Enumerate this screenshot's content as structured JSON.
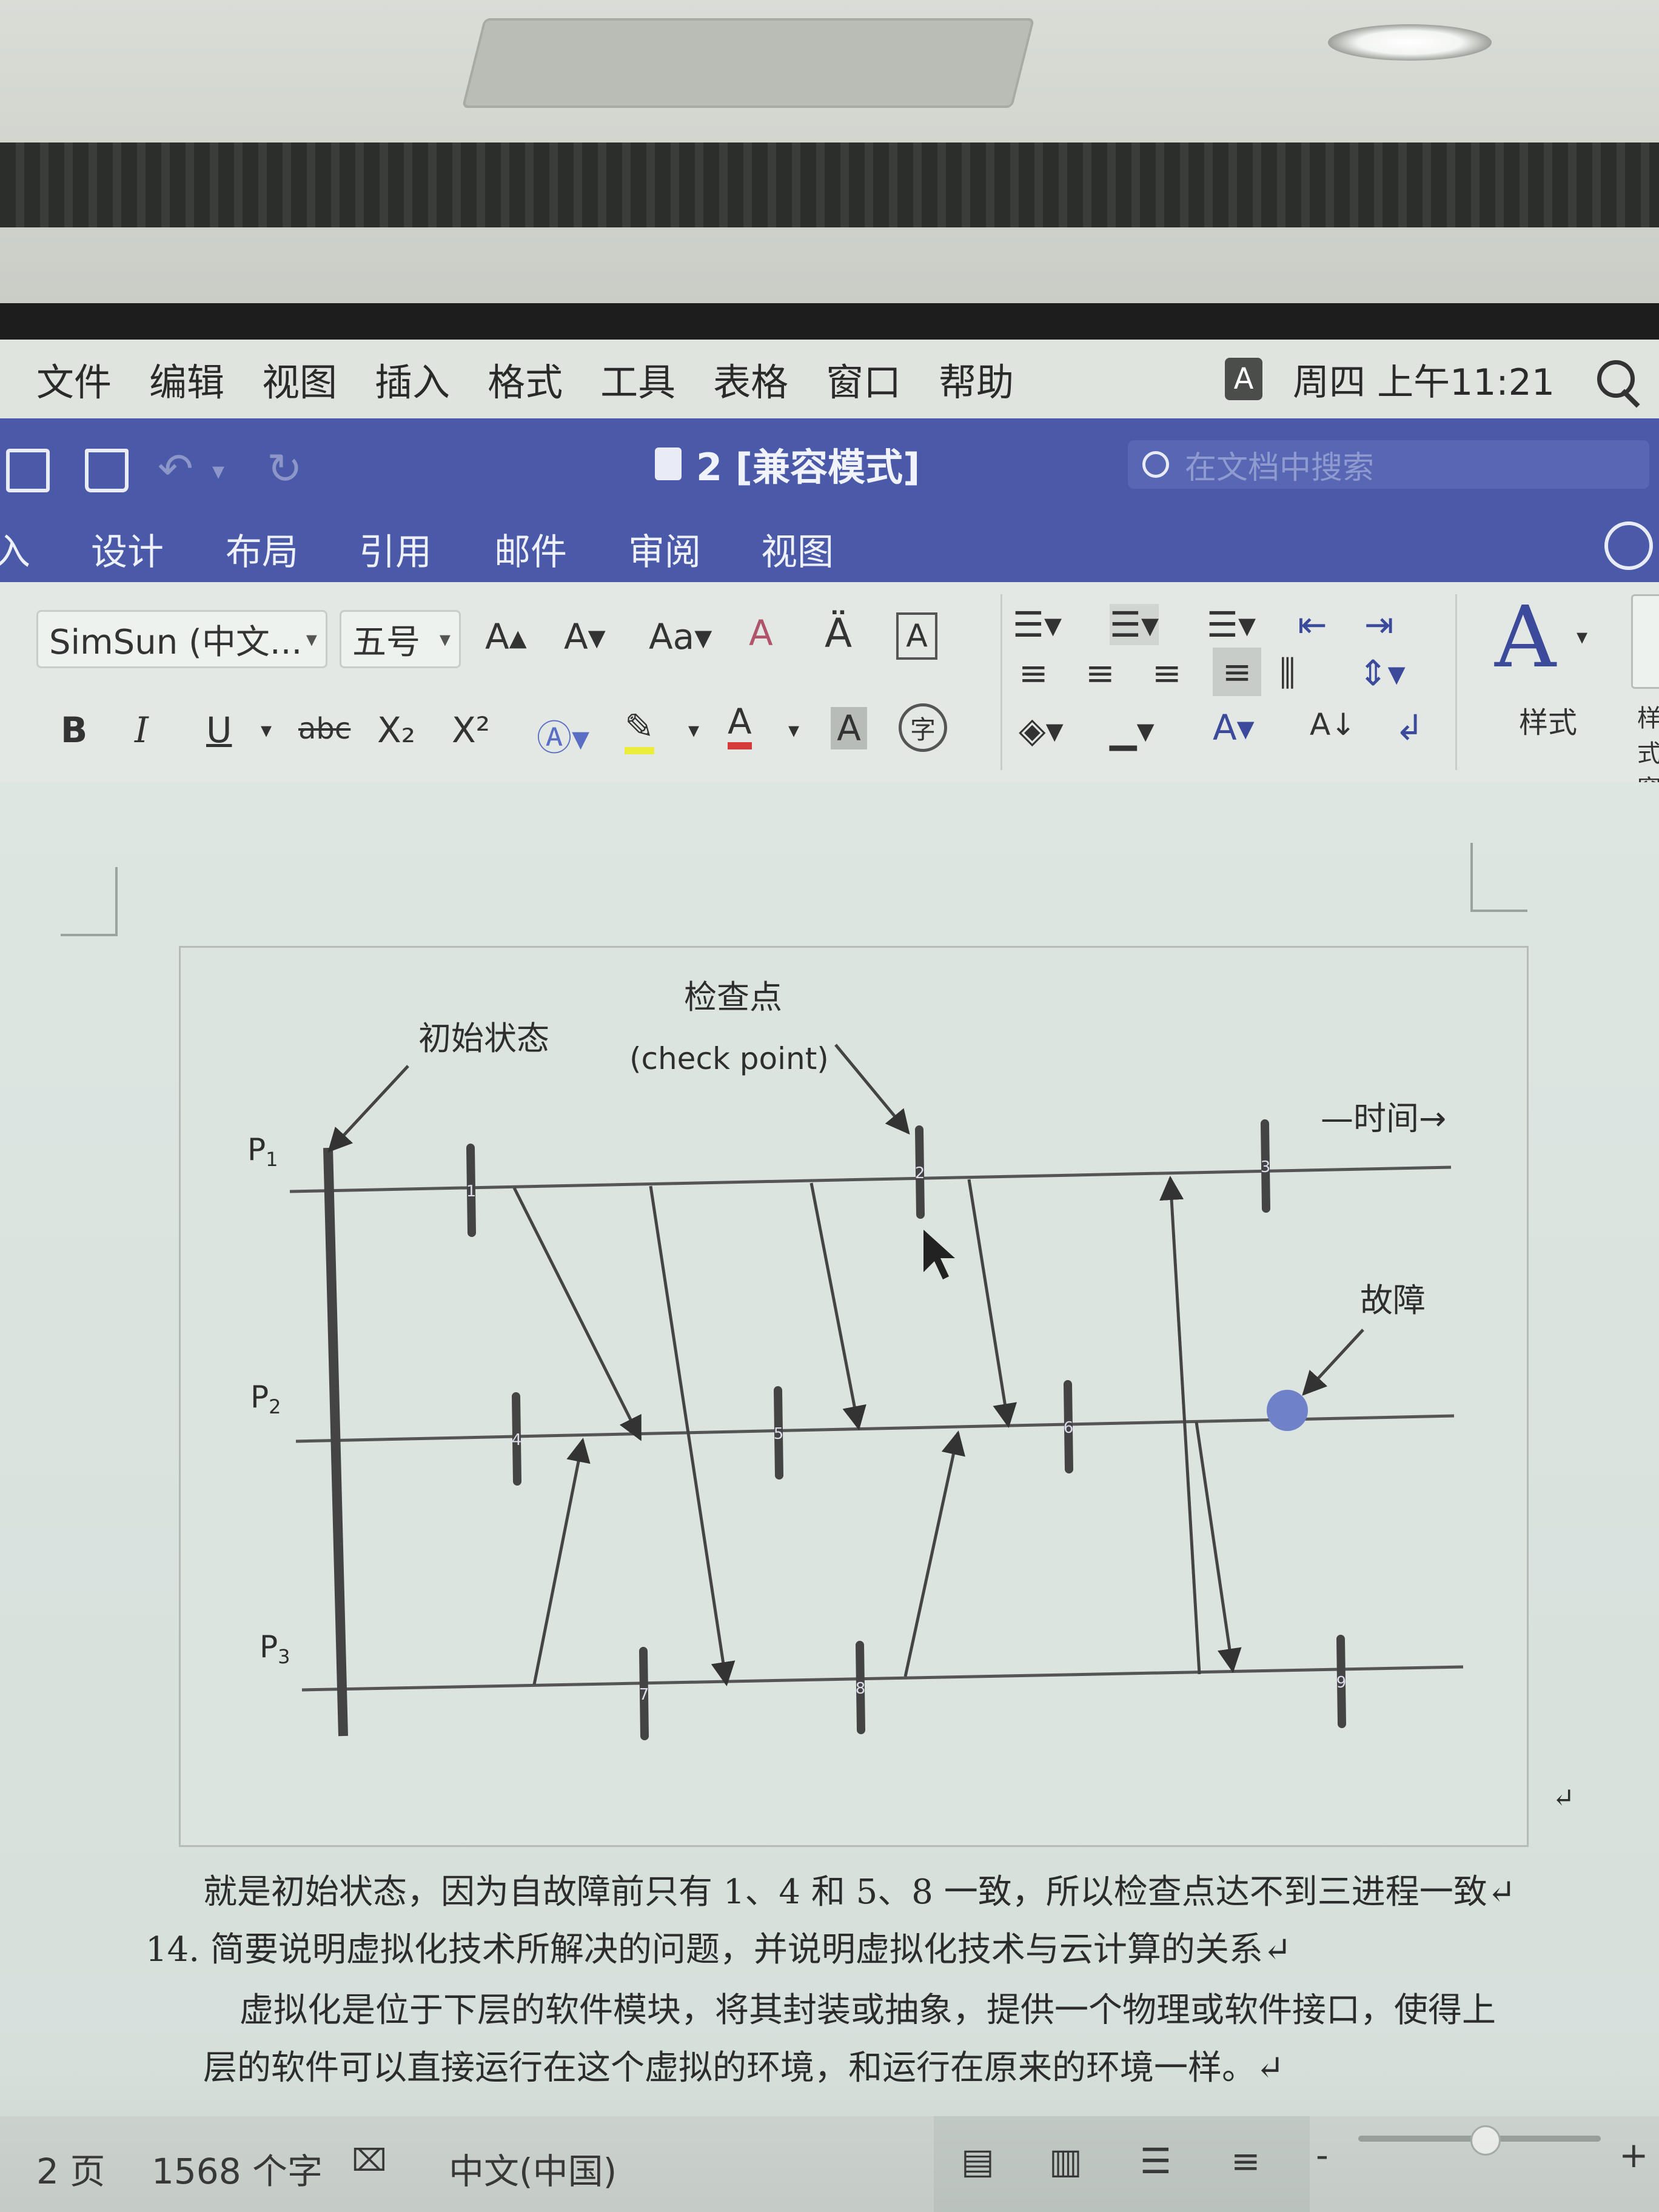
{
  "menubar": {
    "items": [
      "文件",
      "编辑",
      "视图",
      "插入",
      "格式",
      "工具",
      "表格",
      "窗口",
      "帮助"
    ],
    "input_badge": "A",
    "clock": "周四 上午11:21"
  },
  "titlebar": {
    "title": "2 [兼容模式]",
    "search_placeholder": "在文档中搜索"
  },
  "tabs": [
    "入",
    "设计",
    "布局",
    "引用",
    "邮件",
    "审阅",
    "视图"
  ],
  "ribbon": {
    "font_name": "SimSun (中文...",
    "font_size": "五号",
    "styles_label": "样式",
    "styles_pane_label": "样式窗"
  },
  "figure": {
    "label_initial": "初始状态",
    "label_checkpoint": "检查点",
    "label_checkpoint_en": "(check point)",
    "label_time": "—时间→",
    "label_fault": "故障",
    "process_1": "P",
    "process_1_sub": "1",
    "process_2": "P",
    "process_2_sub": "2",
    "process_3": "P",
    "process_3_sub": "3",
    "checkpoints": [
      "1",
      "2",
      "3",
      "4",
      "5",
      "6",
      "7",
      "8",
      "9"
    ]
  },
  "document": {
    "line1": "就是初始状态，因为自故障前只有 1、4 和 5、8 一致，所以检查点达不到三进程一致↵",
    "line2": "14. 简要说明虚拟化技术所解决的问题，并说明虚拟化技术与云计算的关系↵",
    "line3": "虚拟化是位于下层的软件模块，将其封装或抽象，提供一个物理或软件接口，使得上",
    "line4": "层的软件可以直接运行在这个虚拟的环境，和运行在原来的环境一样。↵",
    "para_mark": "↵"
  },
  "statusbar": {
    "page": "2 页",
    "words": "1568 个字",
    "language": "中文(中国)"
  },
  "colors": {
    "word_blue": "#4b5aa8",
    "fault_dot": "#6f82c9"
  }
}
